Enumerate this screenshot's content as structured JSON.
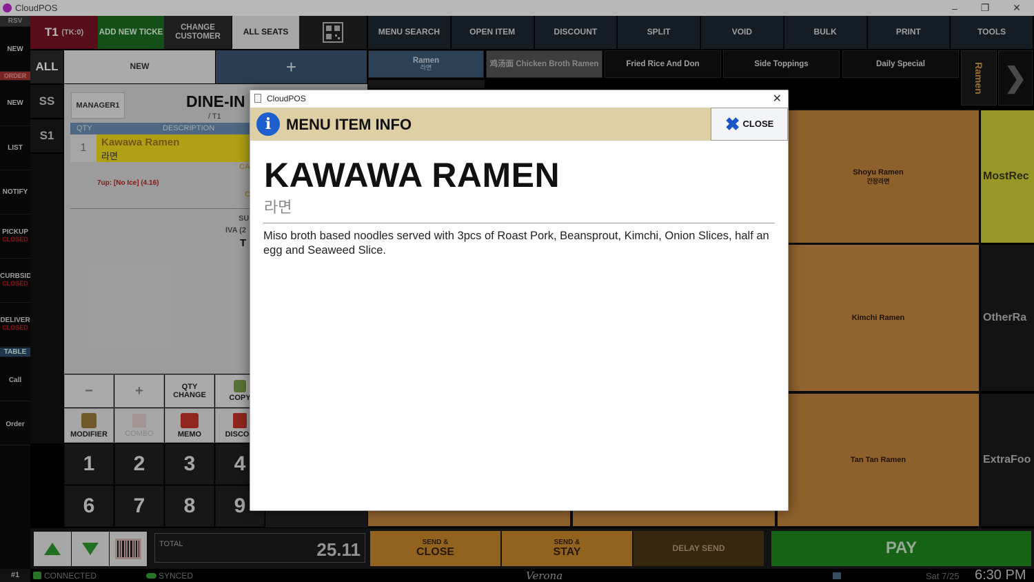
{
  "window": {
    "title": "CloudPOS"
  },
  "left_sidebar": {
    "items": [
      {
        "label": "RSV",
        "sub": ""
      },
      {
        "label": "NEW",
        "sub": ""
      },
      {
        "label": "ORDER",
        "sub": ""
      },
      {
        "label": "NEW",
        "sub": ""
      },
      {
        "label": "LIST",
        "sub": ""
      },
      {
        "label": "NOTIFY",
        "sub": ""
      },
      {
        "label": "PICKUP",
        "sub": "CLOSED"
      },
      {
        "label": "CURBSID",
        "sub": "CLOSED"
      },
      {
        "label": "DELIVER",
        "sub": "CLOSED"
      },
      {
        "label": "TABLE",
        "sub": ""
      },
      {
        "label": "Call",
        "sub": ""
      },
      {
        "label": "Order",
        "sub": ""
      }
    ]
  },
  "top_toolbar": {
    "ticket": "T1",
    "ticket_sub": "(TK:0)",
    "add_new_ticket": "ADD NEW TICKE",
    "change_customer": "CHANGE CUSTOMER",
    "all_seats": "ALL SEATS",
    "buttons": [
      "MENU SEARCH",
      "OPEN ITEM",
      "DISCOUNT",
      "SPLIT",
      "VOID",
      "BULK",
      "PRINT",
      "TOOLS"
    ]
  },
  "seats": {
    "all": "ALL",
    "ss": "SS",
    "s1": "S1",
    "new": "NEW",
    "plus": "+"
  },
  "order": {
    "manager": "MANAGER1",
    "order_type": "DINE-IN",
    "table": "/ T1",
    "col_qty": "QTY",
    "col_desc": "DESCRIPTION",
    "item_qty": "1",
    "item_name": "Kawawa Ramen",
    "item_sub": "라면",
    "item_tag1": "CA",
    "item_tag2": "C",
    "modifier_line": "7up: [No Ice] (4.16)",
    "subtotal_label": "SU",
    "tax_label": "IVA (2",
    "total_label": "T"
  },
  "actions": {
    "minus": "−",
    "plus": "+",
    "qty_change": "QTY CHANGE",
    "copy": "COPY",
    "modifier": "MODIFIER",
    "combo": "COMBO",
    "memo": "MEMO",
    "discount": "DISCOU"
  },
  "numpad": {
    "row1": [
      "1",
      "2",
      "3",
      "4"
    ],
    "row2": [
      "6",
      "7",
      "8",
      "9"
    ]
  },
  "categories": {
    "ramen": "Ramen",
    "ramen_sub": "라면",
    "chicken": "鸡汤面 Chicken Broth Ramen",
    "fried": "Fried Rice And Don",
    "side": "Side Toppings",
    "daily": "Daily Special",
    "vertical": "Ramen"
  },
  "menu_tiles": [
    {
      "name": "Shoyu Ramen",
      "sub": "간장라면"
    },
    {
      "name": "Kimchi Ramen",
      "sub": ""
    },
    {
      "name": "Tan Tan Ramen",
      "sub": ""
    }
  ],
  "right_tiles": [
    "MostRec",
    "OtherRa",
    "ExtraFoo"
  ],
  "bottom": {
    "total_label": "TOTAL",
    "total_value": "25.11",
    "send_close_top": "SEND &",
    "send_close_bottom": "CLOSE",
    "send_stay_top": "SEND &",
    "send_stay_bottom": "STAY",
    "delay_send": "DELAY SEND",
    "pay": "PAY"
  },
  "status": {
    "station": "#1",
    "connected": "CONNECTED",
    "synced": "SYNCED",
    "location": "Verona",
    "date": "Sat 7/25",
    "time": "6:30 PM"
  },
  "modal": {
    "window_title": "CloudPOS",
    "header": "MENU ITEM INFO",
    "close_label": "CLOSE",
    "item_name": "KAWAWA RAMEN",
    "item_subtitle": "라면",
    "description": "Miso broth based noodles served with 3pcs of Roast Pork, Beansprout, Kimchi, Onion Slices, half an egg and Seaweed Slice."
  },
  "colors": {
    "pay": "#1f8a1f",
    "send": "#c98a2a",
    "tile": "#c98a3c",
    "accent_info": "#1e5fd0",
    "header_band": "#ded0a4"
  }
}
